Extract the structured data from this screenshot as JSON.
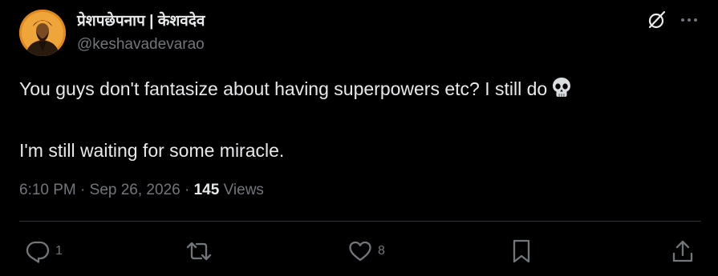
{
  "author": {
    "display_name": "प्रेशपछेपनाप | केशवदेव",
    "handle": "@keshavadevarao"
  },
  "tweet": {
    "line1": "You guys don't fantasize about having superpowers etc? I still do",
    "line2": "I'm still waiting for some miracle.",
    "emoji_icon": "skull-icon"
  },
  "meta": {
    "time": "6:10 PM",
    "sep1": " · ",
    "date": "Sep 26, 2026",
    "sep2": " · ",
    "views_count": "145",
    "views_label": " Views"
  },
  "actions": {
    "reply_count": "1",
    "repost_count": "",
    "like_count": "8"
  },
  "colors": {
    "background": "#000000",
    "text": "#e7e9ea",
    "secondary": "#71767b",
    "divider": "#2f3336"
  }
}
